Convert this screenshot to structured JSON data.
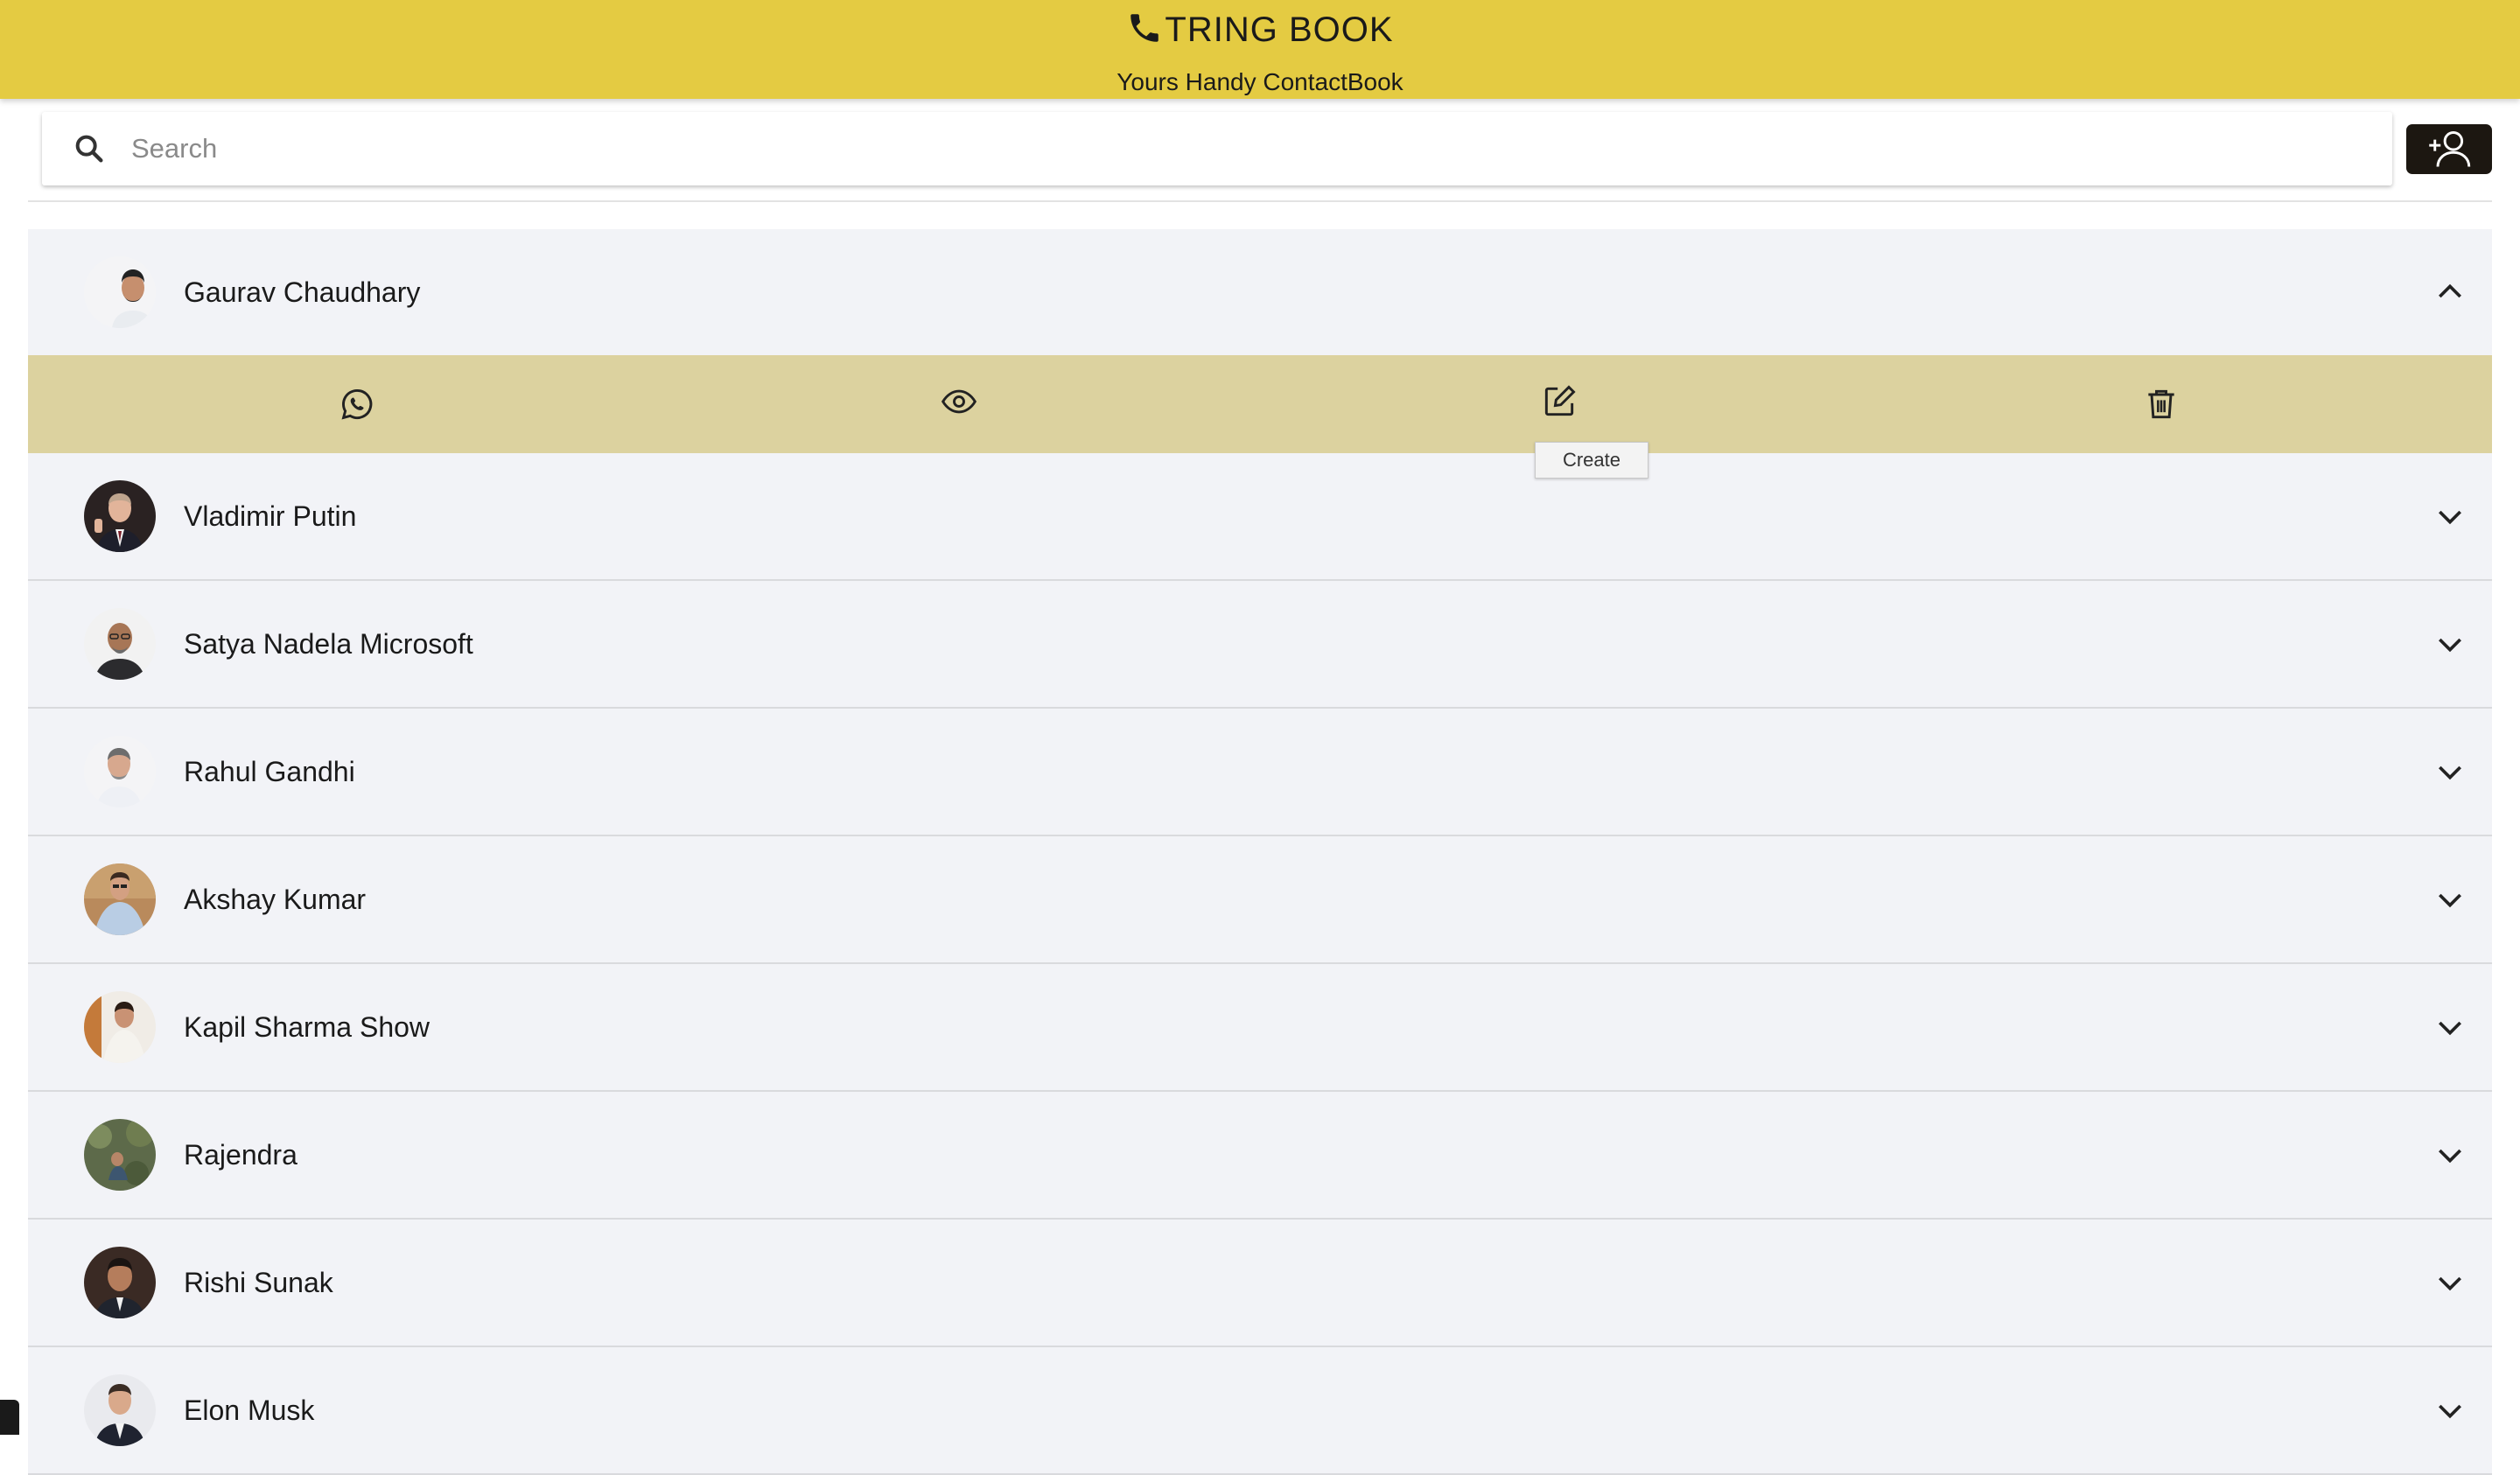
{
  "header": {
    "title": "TRING BOOK",
    "subtitle": "Yours Handy ContactBook",
    "icon": "phone-icon",
    "color": "#e4cb42"
  },
  "search": {
    "placeholder": "Search",
    "value": ""
  },
  "add_button": {
    "icon": "add-user-icon"
  },
  "actions": [
    {
      "icon": "whatsapp-icon"
    },
    {
      "icon": "eye-icon"
    },
    {
      "icon": "edit-icon"
    },
    {
      "icon": "trash-icon"
    }
  ],
  "tooltip": "Create",
  "contacts": [
    {
      "name": "Gaurav Chaudhary",
      "expanded": true
    },
    {
      "name": "Vladimir Putin",
      "expanded": false
    },
    {
      "name": "Satya Nadela Microsoft",
      "expanded": false
    },
    {
      "name": "Rahul Gandhi",
      "expanded": false
    },
    {
      "name": "Akshay Kumar",
      "expanded": false
    },
    {
      "name": "Kapil Sharma Show",
      "expanded": false
    },
    {
      "name": "Rajendra",
      "expanded": false
    },
    {
      "name": "Rishi Sunak",
      "expanded": false
    },
    {
      "name": "Elon Musk",
      "expanded": false
    }
  ],
  "colors": {
    "row_bg": "#f2f3f7",
    "action_bar": "#dcd29f",
    "add_button_bg": "#1c1711"
  }
}
